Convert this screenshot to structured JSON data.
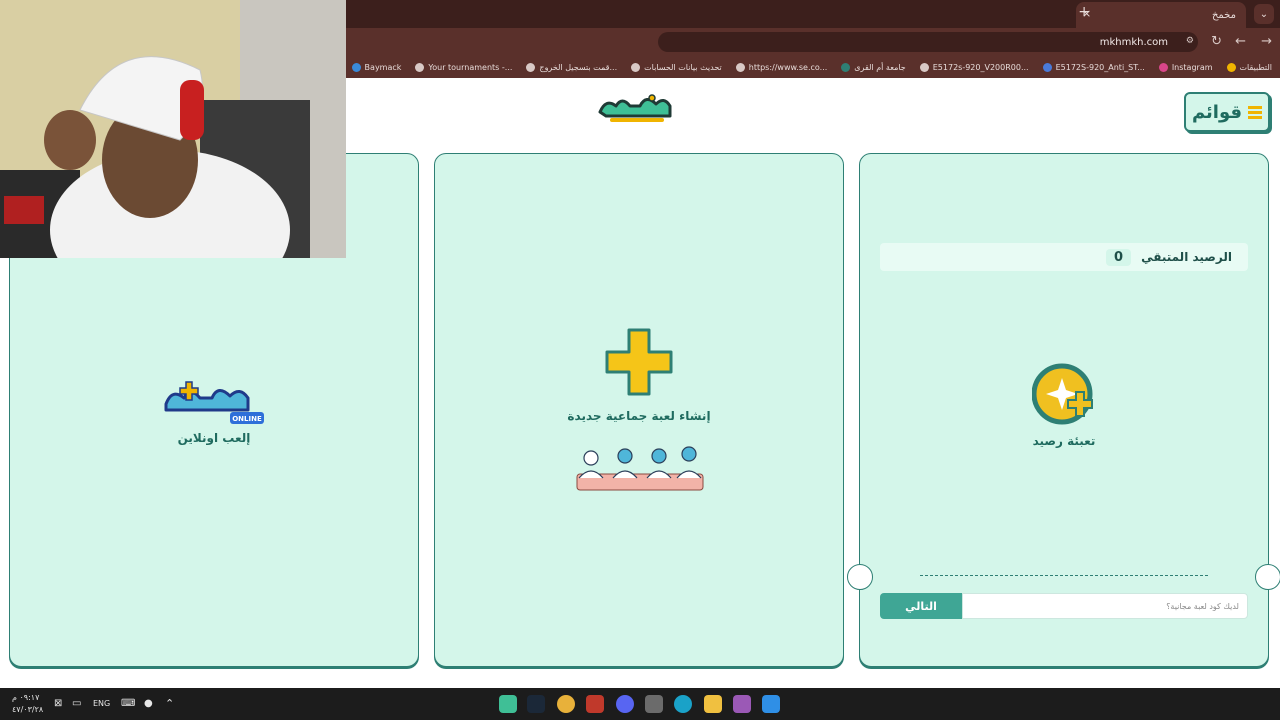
{
  "browser": {
    "tab_title": "مخمخ",
    "tab_close": "×",
    "new_tab": "+",
    "url": "mkhmkh.com",
    "bookmarks": [
      "التطبيقات",
      "Instagram",
      "E5172S-920_Anti_ST...",
      "E5172s-920_V200R00...",
      "جامعة أم القرى",
      "https://www.se.co...",
      "تحديث بيانات الحسابات",
      "قمت بتسجيل الخروج...",
      "Your tournaments -...",
      "Baymack"
    ]
  },
  "header": {
    "menu_label": "قوائم"
  },
  "balance_card": {
    "balance_label": "الرصيد المتبقي",
    "balance_value": "0",
    "recharge_label": "تعبئة رصيد",
    "code_placeholder": "لديك كود لعبة مجانية؟",
    "next_label": "التالي"
  },
  "group_card": {
    "label": "إنشاء لعبة جماعية جديدة"
  },
  "online_card": {
    "logo_badge": "ONLINE",
    "label": "إلعب اونلاين"
  },
  "taskbar": {
    "lang": "ENG",
    "time": "٠٩:١٧ م",
    "date": "٤٧/٠٣/٢٨"
  },
  "colors": {
    "card_bg": "#d4f6ea",
    "card_border": "#2e7f74",
    "accent_yellow": "#f0b400",
    "button_teal": "#3fa695"
  }
}
